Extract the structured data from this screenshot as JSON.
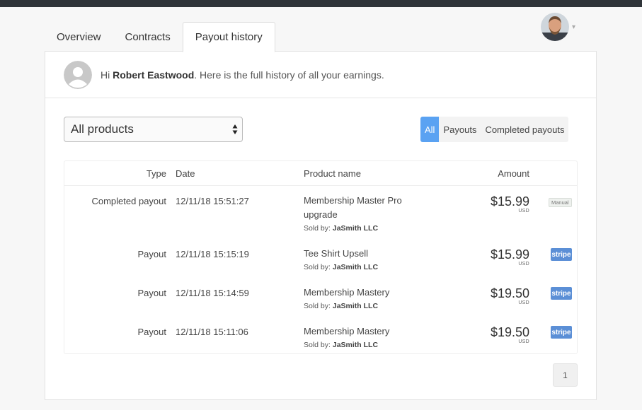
{
  "tabs": [
    {
      "label": "Overview"
    },
    {
      "label": "Contracts"
    },
    {
      "label": "Payout history"
    }
  ],
  "greeting": {
    "prefix": "Hi",
    "name": "Robert Eastwood",
    "suffix": ". Here is the full history of all your earnings."
  },
  "product_select": {
    "value": "All products"
  },
  "filters": [
    {
      "label": "All"
    },
    {
      "label": "Payouts"
    },
    {
      "label": "Completed payouts"
    }
  ],
  "table": {
    "headers": {
      "type": "Type",
      "date": "Date",
      "product": "Product name",
      "amount": "Amount"
    },
    "sold_by_label": "Sold by:",
    "rows": [
      {
        "type": "Completed payout",
        "date": "12/11/18 15:51:27",
        "product": "Membership Master Pro upgrade",
        "seller": "JaSmith LLC",
        "amount": "$15.99",
        "currency": "USD",
        "method": "Manual"
      },
      {
        "type": "Payout",
        "date": "12/11/18 15:15:19",
        "product": "Tee Shirt Upsell",
        "seller": "JaSmith LLC",
        "amount": "$15.99",
        "currency": "USD",
        "method": "stripe"
      },
      {
        "type": "Payout",
        "date": "12/11/18 15:14:59",
        "product": "Membership Mastery",
        "seller": "JaSmith LLC",
        "amount": "$19.50",
        "currency": "USD",
        "method": "stripe"
      },
      {
        "type": "Payout",
        "date": "12/11/18 15:11:06",
        "product": "Membership Mastery",
        "seller": "JaSmith LLC",
        "amount": "$19.50",
        "currency": "USD",
        "method": "stripe"
      }
    ]
  },
  "pagination": {
    "current": "1"
  },
  "colors": {
    "accent": "#5aa2f2",
    "stripe": "#5b8fd6",
    "topbar": "#2f3439"
  },
  "icons": {
    "user_avatar": "avatar-icon",
    "placeholder_avatar": "user-placeholder-icon",
    "select_arrows": "updown-arrows-icon",
    "dropdown": "chevron-down-icon"
  }
}
